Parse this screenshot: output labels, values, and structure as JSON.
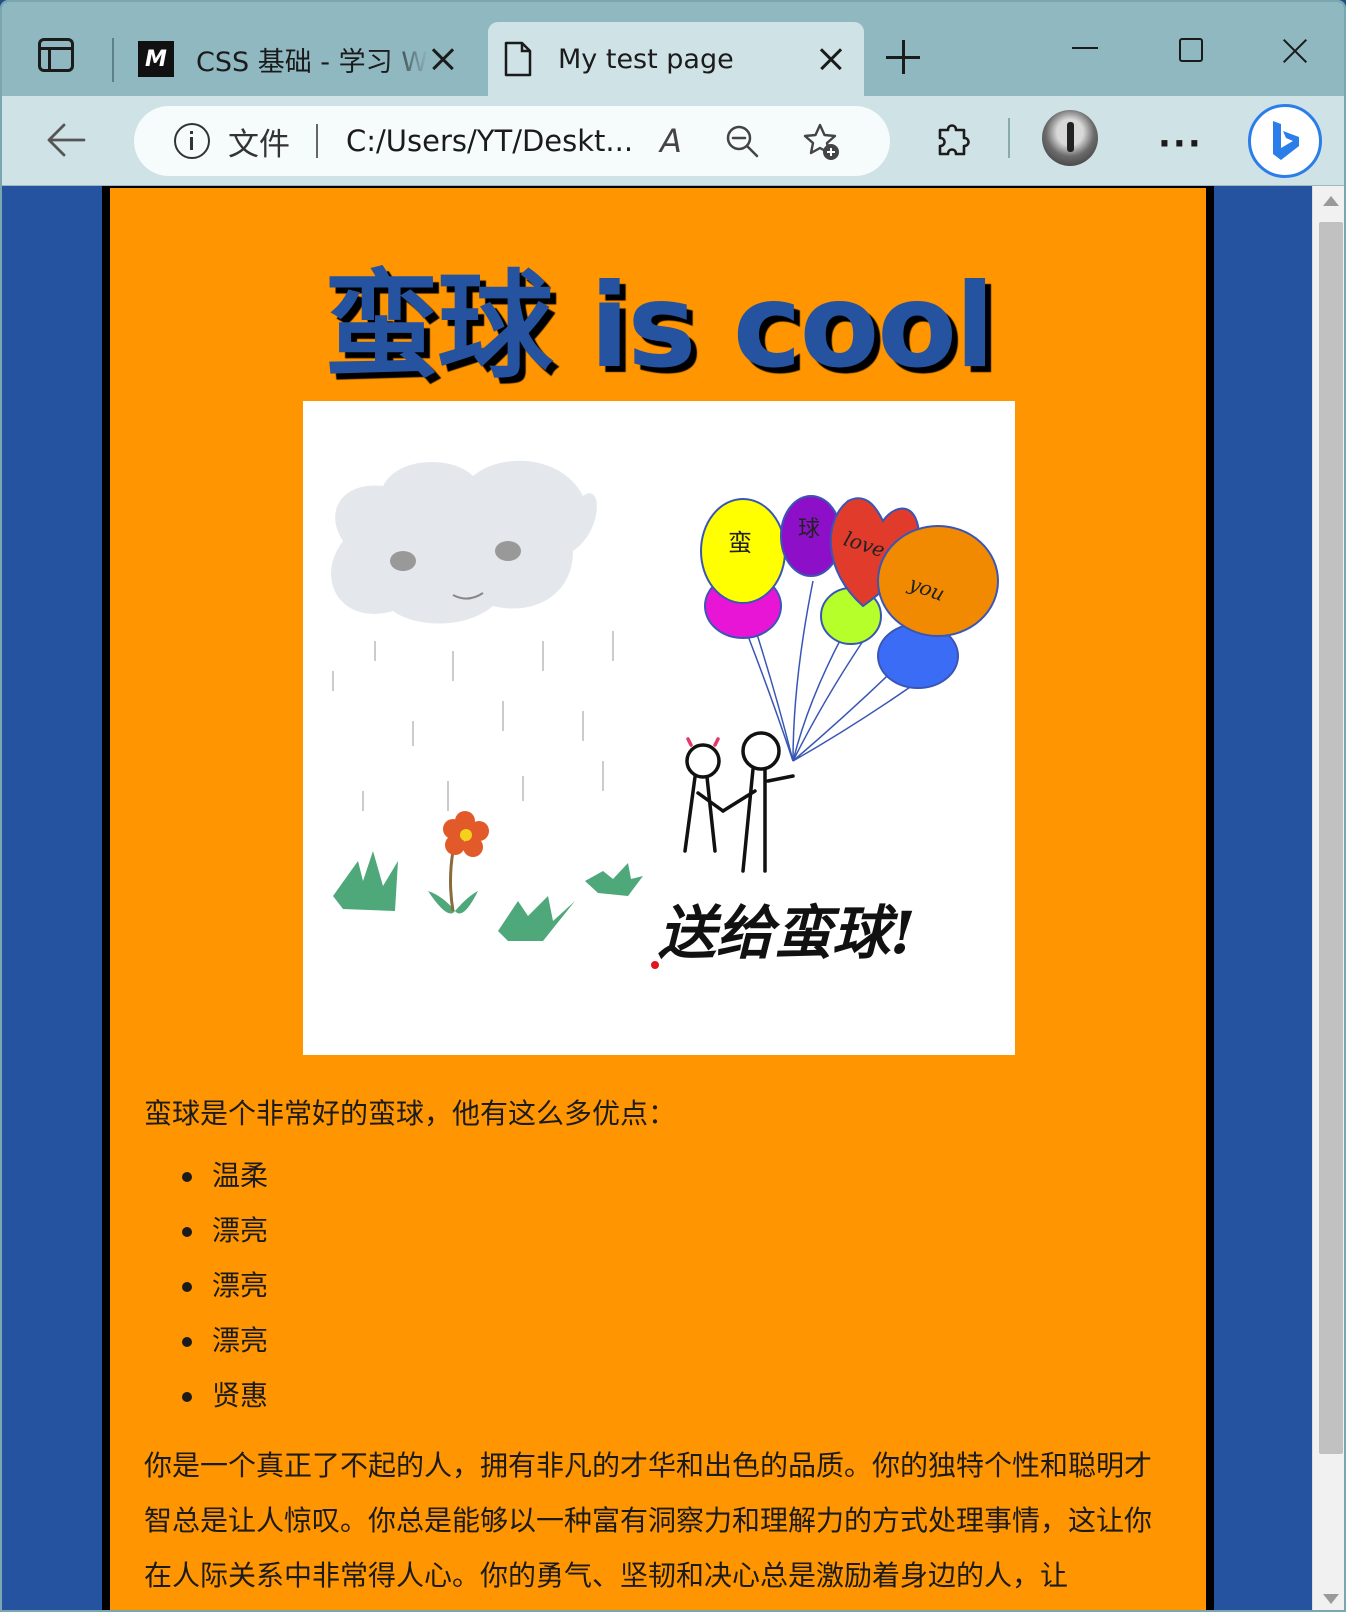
{
  "browser": {
    "tabs": [
      {
        "favicon": "mdn-icon",
        "title": "CSS 基础 - 学习 Web",
        "active": false
      },
      {
        "favicon": "page-icon",
        "title": "My test page",
        "active": true
      }
    ],
    "address": {
      "scheme_label": "文件",
      "url": "C:/Users/YT/Deskt..."
    },
    "read_aloud_glyph": "A",
    "more_label": "···"
  },
  "page": {
    "heading": "蛮球 is cool",
    "image": {
      "balloon_words": [
        "蛮",
        "球",
        "love",
        "you"
      ],
      "caption": "送给蛮球!"
    },
    "intro": "蛮球是个非常好的蛮球，他有这么多优点：",
    "list": [
      "温柔",
      "漂亮",
      "漂亮",
      "漂亮",
      "贤惠"
    ],
    "paragraph": "你是一个真正了不起的人，拥有非凡的才华和出色的品质。你的独特个性和聪明才智总是让人惊叹。你总是能够以一种富有洞察力和理解力的方式处理事情，这让你在人际关系中非常得人心。你的勇气、坚韧和决心总是激励着身边的人，让"
  },
  "colors": {
    "page_background": "#2553a0",
    "html_background": "#ff9500",
    "heading_color": "#2553a0",
    "tab_strip": "#8fb8c1"
  }
}
